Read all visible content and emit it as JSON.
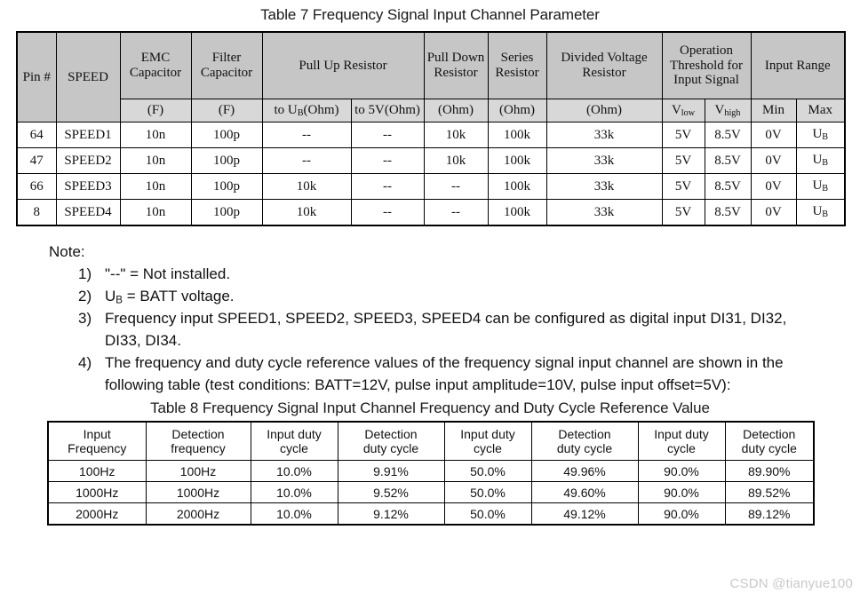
{
  "table7": {
    "title": "Table 7 Frequency Signal Input Channel Parameter",
    "header_groups": {
      "pin": "Pin #",
      "speed": "SPEED",
      "emc_capacitor": "EMC Capacitor",
      "filter_capacitor": "Filter Capacitor",
      "pull_up_resistor": "Pull Up Resistor",
      "pull_down_resistor": "Pull Down Resistor",
      "series_resistor": "Series Resistor",
      "divided_voltage_resistor": "Divided Voltage Resistor",
      "operation_threshold": "Operation Threshold for Input Signal",
      "input_range": "Input Range"
    },
    "header_units": {
      "emc_capacitor": "(F)",
      "filter_capacitor": "(F)",
      "pull_up_to_ub": "to UB(Ohm)",
      "pull_up_to_5v": "to 5V(Ohm)",
      "pull_down": "(Ohm)",
      "series": "(Ohm)",
      "divided": "(Ohm)",
      "v_low": "Vlow",
      "v_high": "Vhigh",
      "min": "Min",
      "max": "Max"
    },
    "rows": [
      {
        "pin": "64",
        "speed": "SPEED1",
        "emc_capacitor": "10n",
        "filter_capacitor": "100p",
        "pull_up_to_ub": "--",
        "pull_up_to_5v": "--",
        "pull_down": "10k",
        "series": "100k",
        "divided": "33k",
        "v_low": "5V",
        "v_high": "8.5V",
        "min": "0V",
        "max": "UB"
      },
      {
        "pin": "47",
        "speed": "SPEED2",
        "emc_capacitor": "10n",
        "filter_capacitor": "100p",
        "pull_up_to_ub": "--",
        "pull_up_to_5v": "--",
        "pull_down": "10k",
        "series": "100k",
        "divided": "33k",
        "v_low": "5V",
        "v_high": "8.5V",
        "min": "0V",
        "max": "UB"
      },
      {
        "pin": "66",
        "speed": "SPEED3",
        "emc_capacitor": "10n",
        "filter_capacitor": "100p",
        "pull_up_to_ub": "10k",
        "pull_up_to_5v": "--",
        "pull_down": "--",
        "series": "100k",
        "divided": "33k",
        "v_low": "5V",
        "v_high": "8.5V",
        "min": "0V",
        "max": "UB"
      },
      {
        "pin": "8",
        "speed": "SPEED4",
        "emc_capacitor": "10n",
        "filter_capacitor": "100p",
        "pull_up_to_ub": "10k",
        "pull_up_to_5v": "--",
        "pull_down": "--",
        "series": "100k",
        "divided": "33k",
        "v_low": "5V",
        "v_high": "8.5V",
        "min": "0V",
        "max": "UB"
      }
    ]
  },
  "notes": {
    "heading": "Note:",
    "items": [
      {
        "num": "1)",
        "text": "\"--\" = Not installed."
      },
      {
        "num": "2)",
        "text": "UB = BATT voltage."
      },
      {
        "num": "3)",
        "text": "Frequency input SPEED1, SPEED2, SPEED3, SPEED4 can be configured as digital input DI31, DI32, DI33, DI34."
      },
      {
        "num": "4)",
        "text": "The frequency and duty cycle reference values of the frequency signal input channel are shown in the following table (test conditions: BATT=12V, pulse input amplitude=10V, pulse input offset=5V):"
      }
    ]
  },
  "table8": {
    "title": "Table 8 Frequency Signal Input Channel Frequency and Duty Cycle Reference Value",
    "columns": [
      "Input Frequency",
      "Detection frequency",
      "Input duty cycle",
      "Detection duty cycle",
      "Input duty cycle",
      "Detection duty cycle",
      "Input duty cycle",
      "Detection duty cycle"
    ],
    "columns_lines": [
      [
        "Input",
        "Frequency"
      ],
      [
        "Detection",
        "frequency"
      ],
      [
        "Input duty",
        "cycle"
      ],
      [
        "Detection",
        "duty cycle"
      ],
      [
        "Input duty",
        "cycle"
      ],
      [
        "Detection",
        "duty cycle"
      ],
      [
        "Input duty",
        "cycle"
      ],
      [
        "Detection",
        "duty cycle"
      ]
    ],
    "rows": [
      [
        "100Hz",
        "100Hz",
        "10.0%",
        "9.91%",
        "50.0%",
        "49.96%",
        "90.0%",
        "89.90%"
      ],
      [
        "1000Hz",
        "1000Hz",
        "10.0%",
        "9.52%",
        "50.0%",
        "49.60%",
        "90.0%",
        "89.52%"
      ],
      [
        "2000Hz",
        "2000Hz",
        "10.0%",
        "9.12%",
        "50.0%",
        "49.12%",
        "90.0%",
        "89.12%"
      ]
    ]
  },
  "watermark": {
    "text": "CSDN @tianyue100"
  }
}
